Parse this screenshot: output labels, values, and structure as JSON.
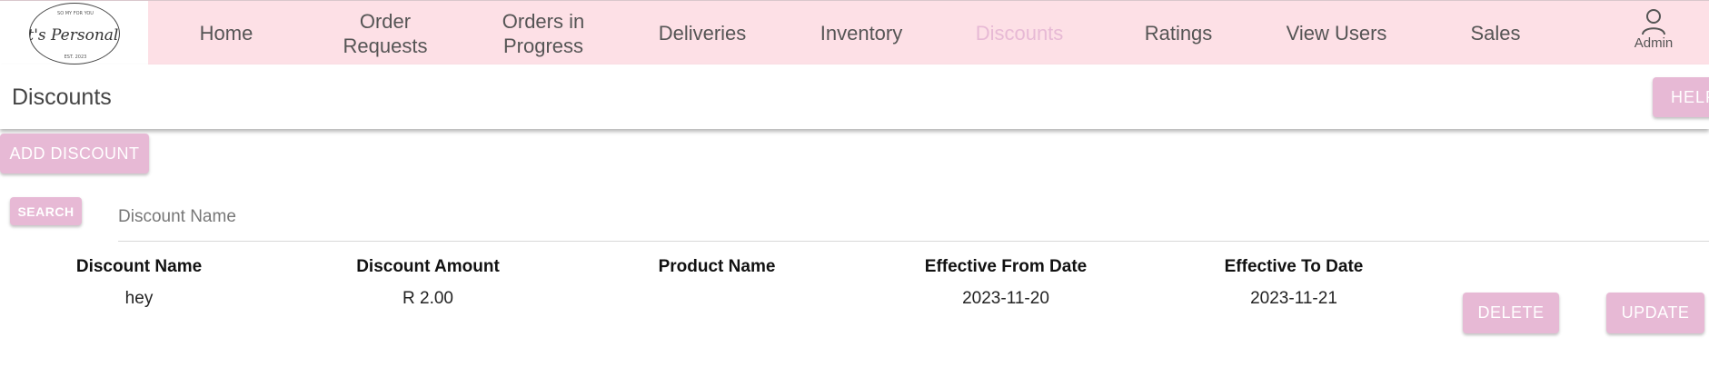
{
  "logo": {
    "script_text": "It's Personal",
    "small_top": "SO MY FOR YOU",
    "small_bottom": "EST. 2023"
  },
  "nav": {
    "items": [
      {
        "label": "Home",
        "active": false
      },
      {
        "label": "Order\nRequests",
        "active": false
      },
      {
        "label": "Orders in\nProgress",
        "active": false
      },
      {
        "label": "Deliveries",
        "active": false
      },
      {
        "label": "Inventory",
        "active": false
      },
      {
        "label": "Discounts",
        "active": true
      },
      {
        "label": "Ratings",
        "active": false
      },
      {
        "label": "View Users",
        "active": false
      },
      {
        "label": "Sales",
        "active": false
      }
    ],
    "admin_label": "Admin",
    "admin_icon": "user-icon"
  },
  "header": {
    "title": "Discounts",
    "help_label": "HELP"
  },
  "actions": {
    "add_label": "ADD DISCOUNT",
    "search_label": "SEARCH",
    "search_placeholder": "Discount Name",
    "search_value": ""
  },
  "table": {
    "columns": [
      "Discount Name",
      "Discount Amount",
      "Product Name",
      "Effective From Date",
      "Effective To Date"
    ],
    "rows": [
      {
        "name": "hey",
        "amount": "R 2.00",
        "product": "",
        "from": "2023-11-20",
        "to": "2023-11-21",
        "delete_label": "DELETE",
        "update_label": "UPDATE"
      }
    ]
  },
  "colors": {
    "nav_bg": "#fde0e6",
    "accent": "#e7b9d5",
    "active_nav": "#e7b9d5"
  }
}
